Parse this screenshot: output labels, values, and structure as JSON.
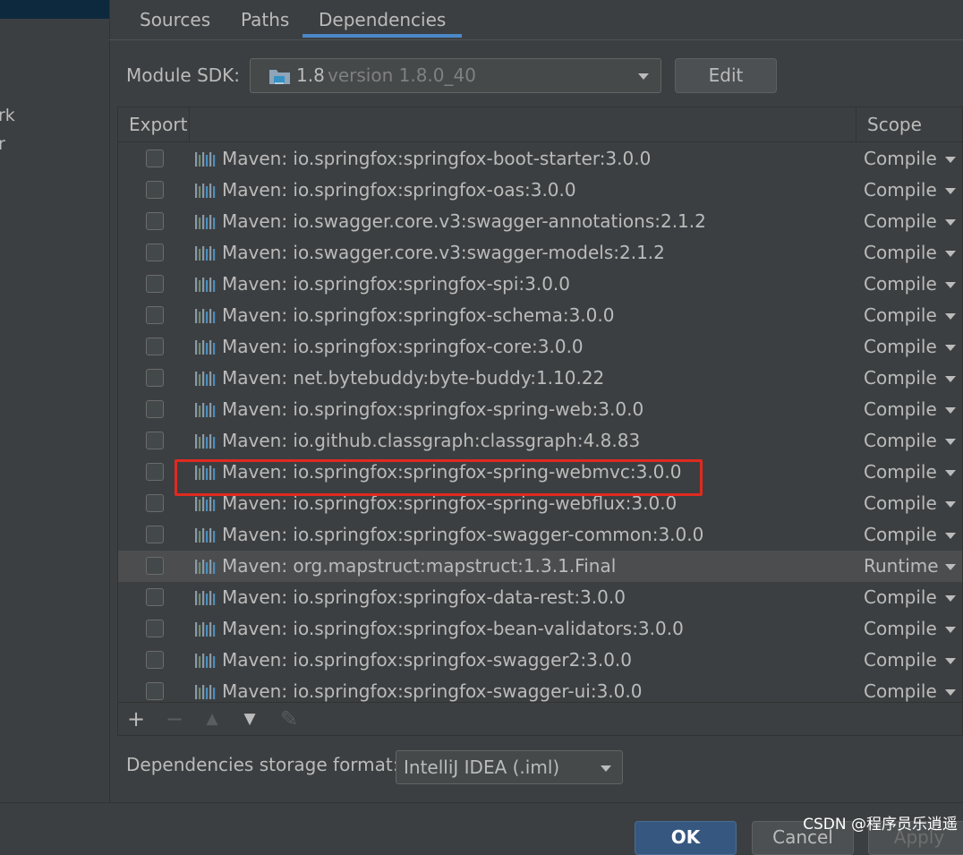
{
  "sidebar": {
    "items": [
      "rk",
      "r"
    ]
  },
  "tabs": [
    {
      "label": "Sources",
      "active": false
    },
    {
      "label": "Paths",
      "active": false
    },
    {
      "label": "Dependencies",
      "active": true
    }
  ],
  "sdk": {
    "label": "Module SDK:",
    "value": "1.8",
    "version_text": "version 1.8.0_40",
    "icon": "folder-java-icon",
    "edit_label": "Edit"
  },
  "table": {
    "headers": {
      "export": "Export",
      "scope": "Scope"
    },
    "rows": [
      {
        "name": "Maven: io.springfox:springfox-boot-starter:3.0.0",
        "scope": "Compile"
      },
      {
        "name": "Maven: io.springfox:springfox-oas:3.0.0",
        "scope": "Compile"
      },
      {
        "name": "Maven: io.swagger.core.v3:swagger-annotations:2.1.2",
        "scope": "Compile"
      },
      {
        "name": "Maven: io.swagger.core.v3:swagger-models:2.1.2",
        "scope": "Compile"
      },
      {
        "name": "Maven: io.springfox:springfox-spi:3.0.0",
        "scope": "Compile"
      },
      {
        "name": "Maven: io.springfox:springfox-schema:3.0.0",
        "scope": "Compile"
      },
      {
        "name": "Maven: io.springfox:springfox-core:3.0.0",
        "scope": "Compile"
      },
      {
        "name": "Maven: net.bytebuddy:byte-buddy:1.10.22",
        "scope": "Compile"
      },
      {
        "name": "Maven: io.springfox:springfox-spring-web:3.0.0",
        "scope": "Compile"
      },
      {
        "name": "Maven: io.github.classgraph:classgraph:4.8.83",
        "scope": "Compile"
      },
      {
        "name": "Maven: io.springfox:springfox-spring-webmvc:3.0.0",
        "scope": "Compile"
      },
      {
        "name": "Maven: io.springfox:springfox-spring-webflux:3.0.0",
        "scope": "Compile"
      },
      {
        "name": "Maven: io.springfox:springfox-swagger-common:3.0.0",
        "scope": "Compile"
      },
      {
        "name": "Maven: org.mapstruct:mapstruct:1.3.1.Final",
        "scope": "Runtime",
        "selected": true
      },
      {
        "name": "Maven: io.springfox:springfox-data-rest:3.0.0",
        "scope": "Compile"
      },
      {
        "name": "Maven: io.springfox:springfox-bean-validators:3.0.0",
        "scope": "Compile"
      },
      {
        "name": "Maven: io.springfox:springfox-swagger2:3.0.0",
        "scope": "Compile"
      },
      {
        "name": "Maven: io.springfox:springfox-swagger-ui:3.0.0",
        "scope": "Compile"
      }
    ]
  },
  "toolbar": {
    "add": "+",
    "remove": "−",
    "move_up": "▲",
    "move_down": "▼",
    "edit": "✎"
  },
  "storage": {
    "label": "Dependencies storage format:",
    "value": "IntelliJ IDEA (.iml)"
  },
  "buttons": {
    "ok": "OK",
    "cancel": "Cancel",
    "apply": "Apply"
  },
  "watermark": "CSDN @程序员乐逍遥",
  "colors": {
    "highlight": "#e02a20",
    "accent": "#4a88c7",
    "ok_button": "#365880"
  }
}
